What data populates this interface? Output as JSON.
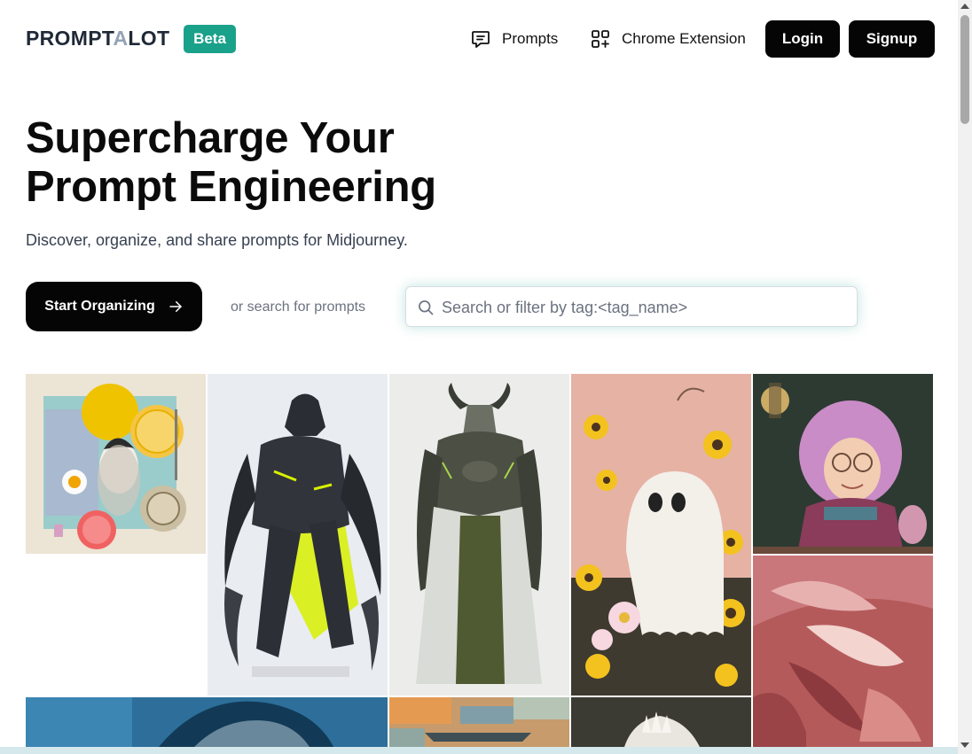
{
  "header": {
    "logo_part1": "PROMPT",
    "logo_part2": "A",
    "logo_part3": "LOT",
    "badge": "Beta",
    "nav": {
      "prompts": "Prompts",
      "chrome_extension": "Chrome Extension"
    },
    "login": "Login",
    "signup": "Signup"
  },
  "hero": {
    "title_line1": "Supercharge Your",
    "title_line2": "Prompt Engineering",
    "subtitle": "Discover, organize, and share prompts for Midjourney.",
    "cta_label": "Start Organizing",
    "or_text": "or search for prompts",
    "search_placeholder": "Search or filter by tag:<tag_name>"
  },
  "gallery": [
    {
      "name": "collage-art-image"
    },
    {
      "name": "dark-armored-creature-image"
    },
    {
      "name": "horned-knight-armor-image"
    },
    {
      "name": "ghost-flowers-image"
    },
    {
      "name": "pink-haired-girl-image"
    },
    {
      "name": "abstract-red-rose-image"
    },
    {
      "name": "blue-portrait-image"
    },
    {
      "name": "abstract-landscape-image"
    },
    {
      "name": "white-fur-image"
    }
  ],
  "colors": {
    "brand_teal": "#1aa18a",
    "button_dark": "#050505"
  },
  "icons": {
    "prompts": "chat-bubble-icon",
    "extension": "apps-plus-icon",
    "search": "search-icon",
    "cta": "arrow-right-icon"
  }
}
